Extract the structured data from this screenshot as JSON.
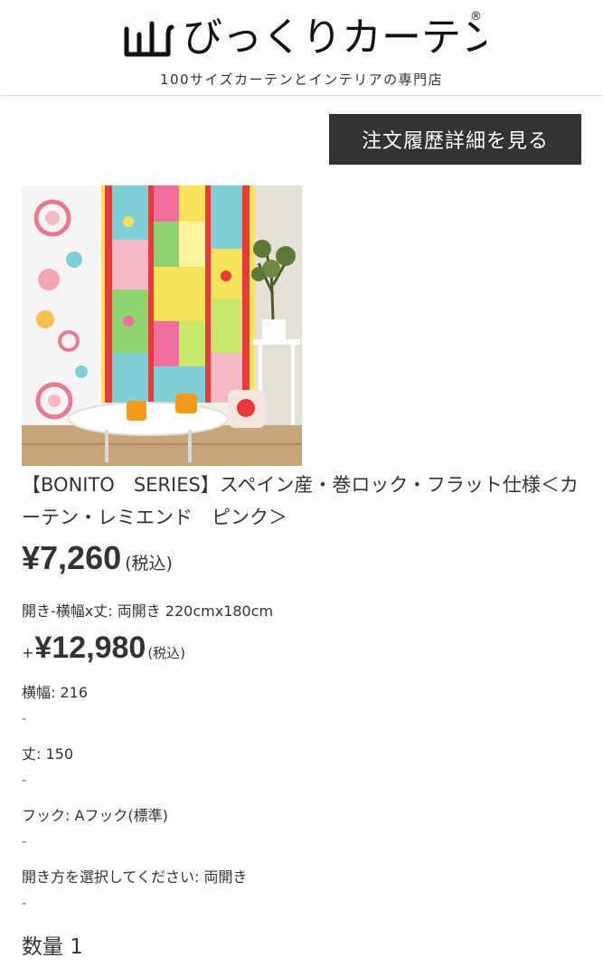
{
  "header": {
    "logo_text": "びっくりカーテン",
    "logo_mark": "®",
    "tagline": "100サイズカーテンとインテリアの専門店"
  },
  "order_button": {
    "label": "注文履歴詳細を見る"
  },
  "product": {
    "title": "【BONITO　SERIES】スペイン産・巻ロック・フラット仕様＜カーテン・レミエンド　ピンク＞",
    "price": "¥7,260",
    "price_tax": "(税込)",
    "open_option": "開き-横幅x丈: 両開き 220cmx180cm",
    "option_prefix": "+",
    "option_price": "¥12,980",
    "option_tax": "(税込)",
    "width": "横幅: 216",
    "dash": "-",
    "length": "丈: 150",
    "hook": "フック: Aフック(標準)",
    "opening": "開き方を選択してください: 両開き",
    "quantity": "数量 1"
  },
  "colors": {
    "button_bg": "#333333",
    "text": "#333333",
    "background": "#ffffff"
  }
}
